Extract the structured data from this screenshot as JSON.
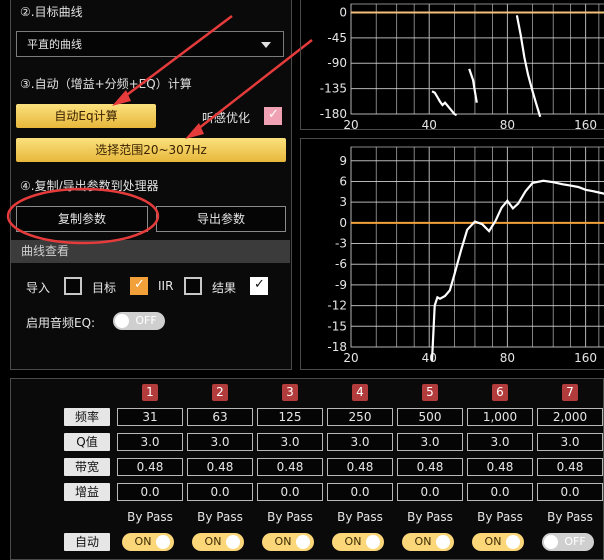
{
  "left_panel": {
    "step2_title": "②.目标曲线",
    "target_curve_select": "平直的曲线",
    "step3_title": "③.自动（增益+分频+EQ）计算",
    "auto_eq_button": "自动Eq计算",
    "listening_opt_label": "听感优化",
    "listening_opt_checked": true,
    "range_button": "选择范围20~307Hz",
    "step4_title": "④.复制/导出参数到处理器",
    "copy_button": "复制参数",
    "export_button": "导出参数",
    "curve_view_header": "曲线查看",
    "checks": [
      {
        "label": "导入",
        "checked": false
      },
      {
        "label": "目标",
        "checked": true
      },
      {
        "label": "IIR",
        "checked": false
      },
      {
        "label": "结果",
        "checked": true
      }
    ],
    "audio_eq_label": "启用音频EQ:",
    "audio_eq_toggle": "OFF"
  },
  "chart_top": {
    "type": "line",
    "y_ticks": [
      "0",
      "-45",
      "-90",
      "-135",
      "-180"
    ],
    "x_ticks": [
      "20",
      "40",
      "80",
      "160"
    ],
    "ylim": [
      -180,
      15
    ],
    "xlim": [
      20,
      190
    ],
    "x_scale": "log",
    "reference_line_y": 0,
    "reference_color": "#f3c07a",
    "series": [
      {
        "x": [
          41,
          42,
          43,
          44,
          45,
          46,
          47,
          48,
          49,
          50,
          51
        ],
        "y": [
          -140,
          -142,
          -150,
          -158,
          -164,
          -160,
          -165,
          -170,
          -175,
          -180,
          -182
        ]
      },
      {
        "x": [
          57,
          59,
          60,
          61
        ],
        "y": [
          -100,
          -120,
          -140,
          -160
        ]
      },
      {
        "x": [
          87,
          90,
          93,
          96,
          100,
          103,
          107
        ],
        "y": [
          -5,
          -40,
          -80,
          -110,
          -140,
          -160,
          -185
        ]
      }
    ]
  },
  "chart_bottom": {
    "type": "line",
    "y_ticks": [
      "9",
      "6",
      "3",
      "0",
      "-3",
      "-6",
      "-9",
      "-12",
      "-15",
      "-18"
    ],
    "x_ticks": [
      "20",
      "40",
      "80",
      "160"
    ],
    "ylim": [
      -18,
      11
    ],
    "xlim": [
      20,
      190
    ],
    "x_scale": "log",
    "reference_line_y": 0,
    "reference_color": "#f3a13a",
    "series": [
      {
        "x": [
          41,
          42,
          43,
          44,
          46,
          48,
          50,
          53,
          56,
          60,
          64,
          68,
          72,
          76,
          80,
          84,
          88,
          94,
          100,
          110,
          120,
          130,
          140,
          150,
          160,
          170,
          180,
          190
        ],
        "y": [
          -20,
          -12,
          -10.8,
          -11,
          -10.6,
          -9.8,
          -7.5,
          -4,
          -1,
          0.2,
          -0.2,
          -1.2,
          0.3,
          2.2,
          3.2,
          2.1,
          2.8,
          4.6,
          5.8,
          6.1,
          5.9,
          5.6,
          5.4,
          5.2,
          4.8,
          4.6,
          4.4,
          4.2
        ]
      }
    ]
  },
  "eq_table": {
    "channels": [
      "1",
      "2",
      "3",
      "4",
      "5",
      "6",
      "7"
    ],
    "row_labels": {
      "freq": "频率",
      "q": "Q值",
      "bw": "带宽",
      "gain": "增益",
      "auto": "自动"
    },
    "freq": [
      "31",
      "63",
      "125",
      "250",
      "500",
      "1,000",
      "2,000"
    ],
    "q": [
      "3.0",
      "3.0",
      "3.0",
      "3.0",
      "3.0",
      "3.0",
      "3.0"
    ],
    "bw": [
      "0.48",
      "0.48",
      "0.48",
      "0.48",
      "0.48",
      "0.48",
      "0.48"
    ],
    "gain": [
      "0.0",
      "0.0",
      "0.0",
      "0.0",
      "0.0",
      "0.0",
      "0.0"
    ],
    "bypass_label": "By Pass",
    "auto": [
      "ON",
      "ON",
      "ON",
      "ON",
      "ON",
      "ON",
      "OFF"
    ]
  },
  "colors": {
    "accent": "#f0c24b",
    "badge": "#b23b3b",
    "annotation": "#e53b3b"
  }
}
